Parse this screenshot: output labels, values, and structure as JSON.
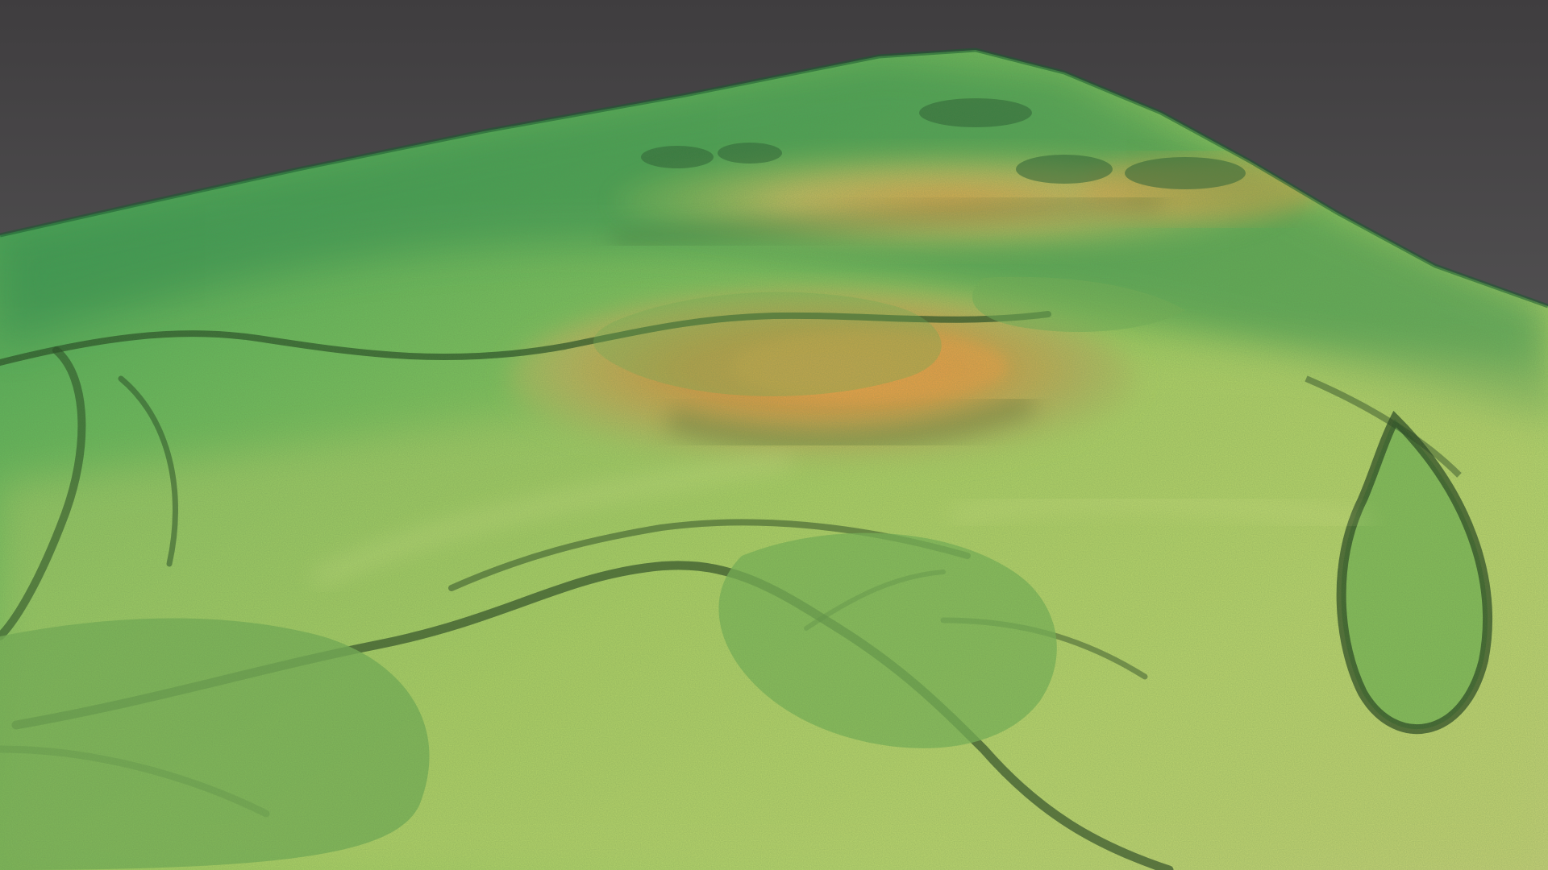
{
  "scene": {
    "kind": "3D terrain elevation render",
    "colors": {
      "background_top": "#3f3d3f",
      "background_bottom": "#6e6e6e",
      "low_elevation": "#2f9a55",
      "mid_elevation": "#8fc85a",
      "upper_mid_elevation": "#c9d27a",
      "high_elevation": "#d99a45",
      "peak_elevation": "#e8a23f",
      "shadow": "#1f4a28",
      "channel_dark": "#244a22"
    },
    "features": [
      "terrain-surface",
      "central-ridge",
      "upper-ridge",
      "left-valley-channel",
      "lower-channel-network",
      "right-elongated-depression",
      "rough-textured-patches"
    ]
  }
}
